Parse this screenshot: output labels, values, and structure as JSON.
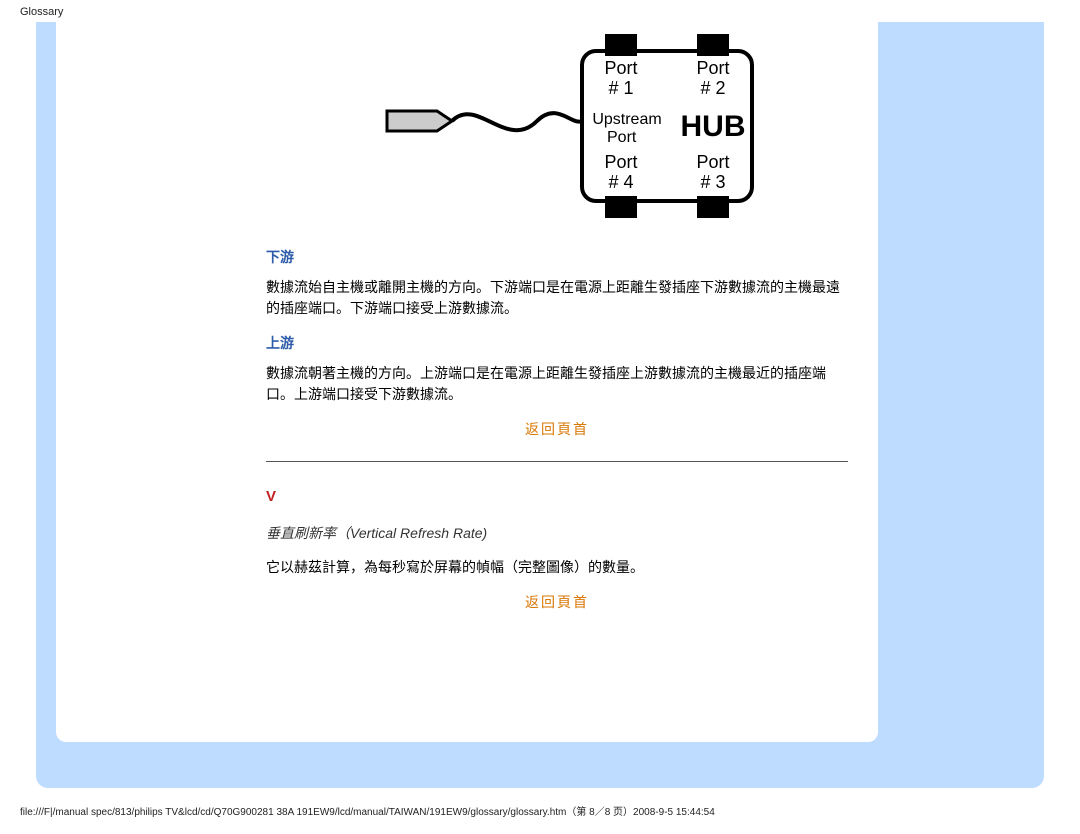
{
  "header": {
    "title": "Glossary"
  },
  "diagram": {
    "port1": "Port\n# 1",
    "port2": "Port\n# 2",
    "port3": "Port\n# 3",
    "port4": "Port\n# 4",
    "upstream": "Upstream\nPort",
    "hub": "HUB"
  },
  "sections": {
    "down_title": "下游",
    "down_body": "數據流始自主機或離開主機的方向。下游端口是在電源上距離生發插座下游數據流的主機最遠的插座端口。下游端口接受上游數據流。",
    "up_title": "上游",
    "up_body": "數據流朝著主機的方向。上游端口是在電源上距離生發插座上游數據流的主機最近的插座端口。上游端口接受下游數據流。",
    "v_letter": "V",
    "v_sub": "垂直刷新率（Vertical Refresh Rate)",
    "v_body": "它以赫茲計算，為每秒寫於屏幕的幀幅（完整圖像）的數量。"
  },
  "links": {
    "back_top": "返回頁首"
  },
  "footer": {
    "path": "file:///F|/manual spec/813/philips TV&lcd/cd/Q70G900281 38A 191EW9/lcd/manual/TAIWAN/191EW9/glossary/glossary.htm（第 8／8 页）2008-9-5 15:44:54"
  }
}
